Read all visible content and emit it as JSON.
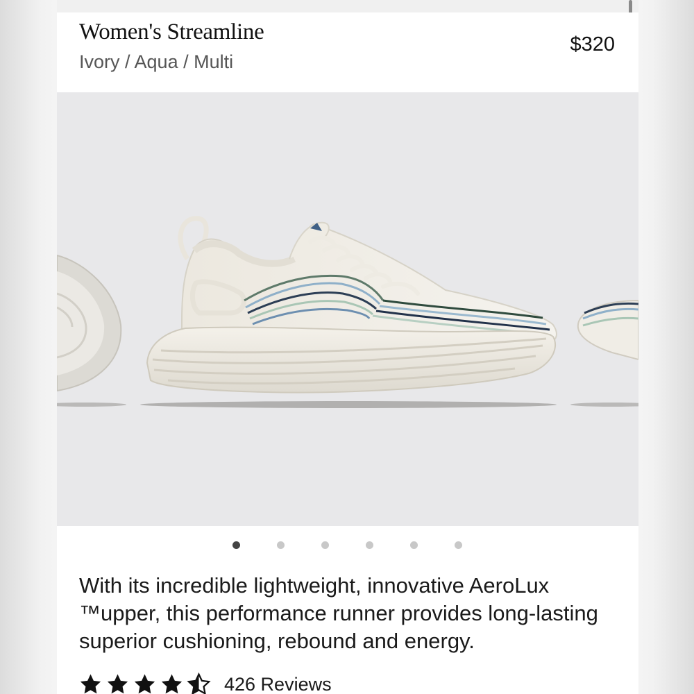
{
  "product": {
    "name": "Women's Streamline",
    "colorway": "Ivory / Aqua / Multi",
    "price": "$320"
  },
  "gallery": {
    "image_description_icon": "sneaker-image",
    "dots_count": 6,
    "active_index": 0,
    "background": "#e8e8ea"
  },
  "description": "With its incredible lightweight, innovative AeroLux ™upper, this performance runner provides long-lasting superior cushioning, rebound and energy.",
  "rating": {
    "stars": 4.5,
    "max_stars": 5,
    "reviews_label": "426 Reviews"
  }
}
